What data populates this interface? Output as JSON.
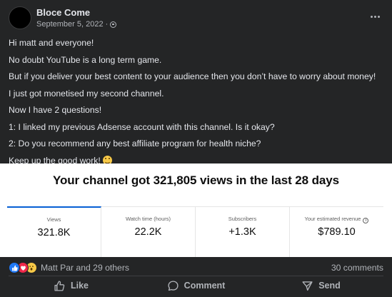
{
  "post": {
    "author": "Bloce Come",
    "date": "September 5, 2022 ·",
    "privacy_icon": "globe-icon",
    "lines": [
      "Hi matt and everyone!",
      "No doubt YouTube is a long term game.",
      "But if you deliver your best content to your audience then you don’t have to worry about money!",
      "I just got monetised my second channel.",
      "Now I have 2 questions!",
      "1: I linked my previous Adsense account with this channel. Is it okay?",
      "2: Do you recommend any best affiliate program for health niche?",
      "Keep up the good work!"
    ]
  },
  "analytics": {
    "title": "Your channel got 321,805 views in the last 28 days",
    "metrics": [
      {
        "label": "Views",
        "value": "321.8K"
      },
      {
        "label": "Watch time (hours)",
        "value": "22.2K"
      },
      {
        "label": "Subscribers",
        "value": "+1.3K"
      },
      {
        "label": "Your estimated revenue",
        "value": "$789.10"
      }
    ],
    "info_icon_glyph": "i"
  },
  "engagement": {
    "reactions_text": "Matt Par and 29 others",
    "comments_text": "30 comments",
    "reaction_icons": [
      "like-icon",
      "love-icon",
      "wow-icon"
    ]
  },
  "actions": {
    "like": "Like",
    "comment": "Comment",
    "send": "Send"
  },
  "colors": {
    "background": "#242526",
    "text_primary": "#e4e6eb",
    "text_secondary": "#b0b3b8",
    "active_tab": "#065fd4",
    "like_blue": "#2078f4",
    "love_red": "#f0284a"
  }
}
